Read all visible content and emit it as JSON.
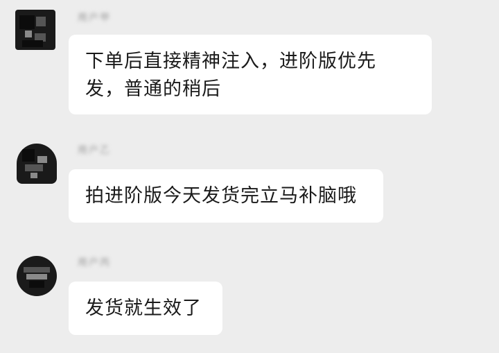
{
  "messages": [
    {
      "sender": "用户甲",
      "lines": [
        "下单后直接精神注入，进阶版优先",
        "发，普通的稍后"
      ]
    },
    {
      "sender": "用户乙",
      "lines": [
        "拍进阶版今天发货完立马补脑哦"
      ]
    },
    {
      "sender": "用户丙",
      "lines": [
        "发货就生效了"
      ]
    }
  ]
}
